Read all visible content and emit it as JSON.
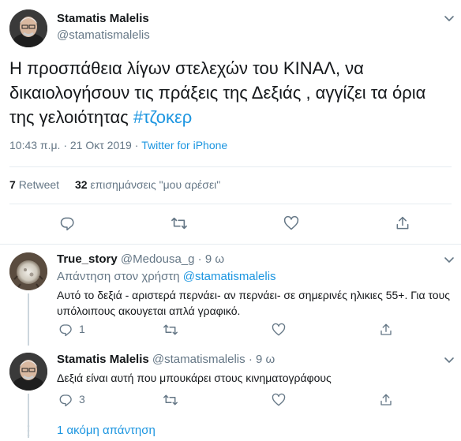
{
  "main_tweet": {
    "author_name": "Stamatis Malelis",
    "handle": "@stamatismalelis",
    "text": "Η προσπάθεια λίγων στελεχών του ΚΙΝΑΛ, να δικαιολογήσουν τις πράξεις της Δεξιάς , αγγίζει τα όρια της γελοιότητας",
    "hashtag": "#τζοκερ",
    "time": "10:43 π.μ.",
    "separator": "·",
    "date": "21 Οκτ 2019",
    "source": "Twitter for iPhone",
    "retweet_count": "7",
    "retweet_label": "Retweet",
    "like_count": "32",
    "like_label": "επισημάνσεις \"μου αρέσει\""
  },
  "replies": [
    {
      "author_name": "True_story",
      "handle": "@Medousa_g",
      "dot": "·",
      "time": "9 ω",
      "reply_to_label": "Απάντηση στον χρήστη",
      "reply_to_handle": "@stamatismalelis",
      "text": "Αυτό το δεξιά - αριστερά περνάει- αν περνάει- σε σημερινές ηλικιες 55+. Για τους υπόλοιπους ακουγεται απλά γραφικό.",
      "reply_count": "1"
    },
    {
      "author_name": "Stamatis Malelis",
      "handle": "@stamatismalelis",
      "dot": "·",
      "time": "9 ω",
      "text": "Δεξιά είναι αυτή που μπουκάρει στους κινηματογράφους",
      "reply_count": "3"
    }
  ],
  "more_replies_label": "1 ακόμη απάντηση",
  "icons": [
    "chevron-down-icon",
    "reply-icon",
    "retweet-icon",
    "like-icon",
    "share-icon"
  ],
  "colors": {
    "link": "#1b95e0",
    "muted": "#657786",
    "text": "#14171a",
    "divider": "#e6ecf0"
  }
}
